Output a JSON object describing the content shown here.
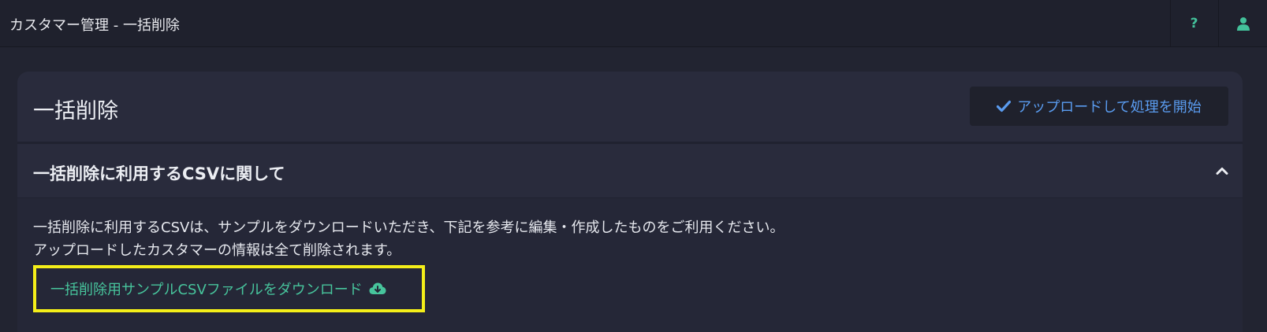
{
  "topbar": {
    "title": "カスタマー管理 - 一括削除",
    "help_label": "?",
    "help_icon": "question-icon",
    "user_icon": "user-icon"
  },
  "card": {
    "title": "一括削除",
    "upload_button": {
      "label": "アップロードして処理を開始",
      "icon": "check-icon"
    }
  },
  "section": {
    "title": "一括削除に利用するCSVに関して",
    "collapse_icon": "chevron-up-icon",
    "description_line1": "一括削除に利用するCSVは、サンプルをダウンロードいただき、下記を参考に編集・作成したものをご利用ください。",
    "description_line2": "アップロードしたカスタマーの情報は全て削除されます。",
    "download_link": {
      "label": "一括削除用サンプルCSVファイルをダウンロード",
      "icon": "cloud-download-icon"
    }
  },
  "colors": {
    "background": "#222431",
    "card": "#292b3c",
    "accent_green": "#47c49c",
    "accent_blue": "#5a9cf0",
    "highlight": "#f4ee19"
  }
}
